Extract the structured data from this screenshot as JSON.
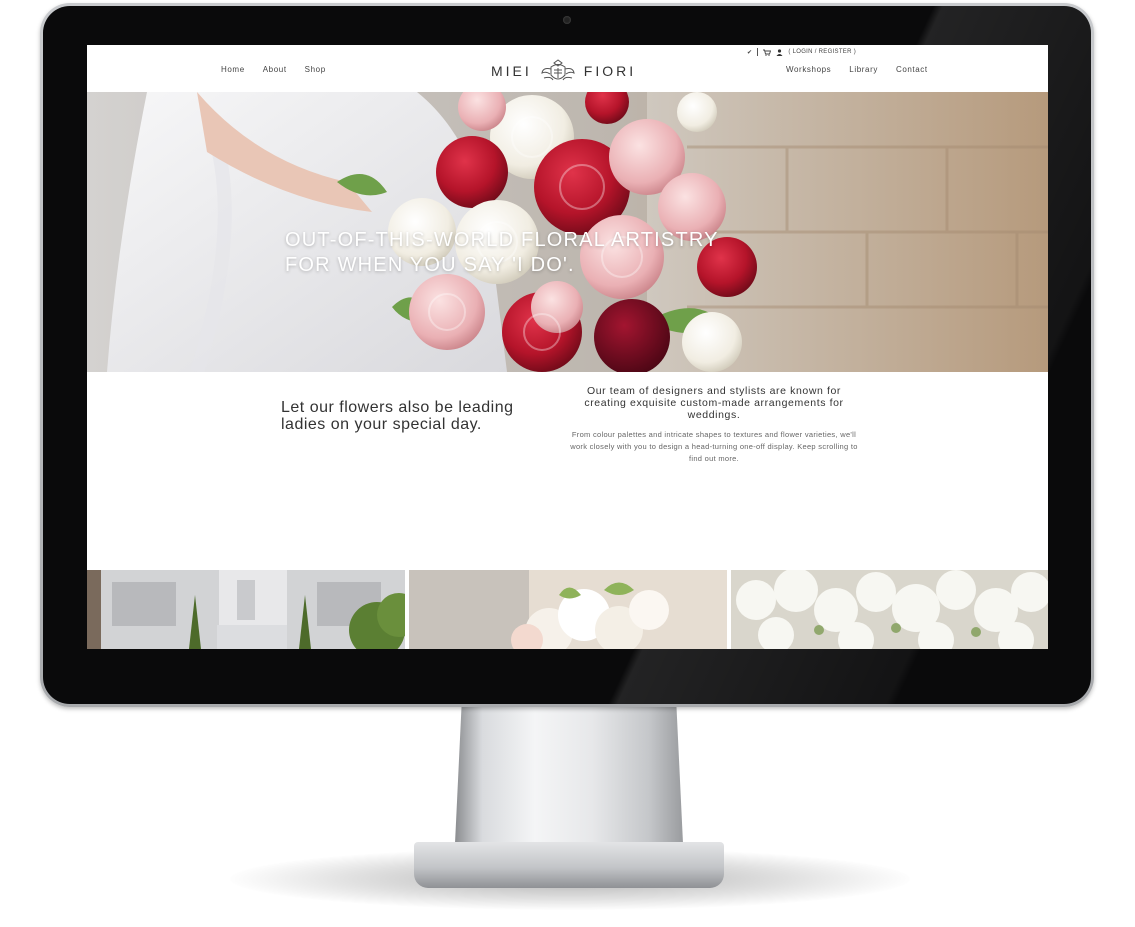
{
  "header": {
    "util": {
      "check_icon": "check-icon",
      "cart_icon": "cart-icon",
      "user_icon": "user-icon",
      "auth_label": "( LOGIN / REGISTER )"
    },
    "nav_left": [
      "Home",
      "About",
      "Shop"
    ],
    "nav_right": [
      "Workshops",
      "Library",
      "Contact"
    ],
    "logo": {
      "left": "MIEI",
      "right": "FIORI"
    }
  },
  "hero": {
    "headline": "OUT-OF-THIS-WORLD FLORAL ARTISTRY\nFOR WHEN YOU SAY 'I DO'."
  },
  "intro": {
    "left": "Let our flowers also be leading ladies on your special day.",
    "right_lead": "Our team of designers and stylists are known for creating exquisite custom-made arrangements for weddings.",
    "right_body": "From colour palettes and intricate shapes to textures and flower varieties, we'll work closely with you to design a head-turning one-off display. Keep scrolling to find out more."
  },
  "colors": {
    "text_dark": "#333333",
    "text_muted": "#666666",
    "rose_red": "#c0182c",
    "rose_pink": "#e9a8ae",
    "bezel": "#0a0a0b"
  }
}
